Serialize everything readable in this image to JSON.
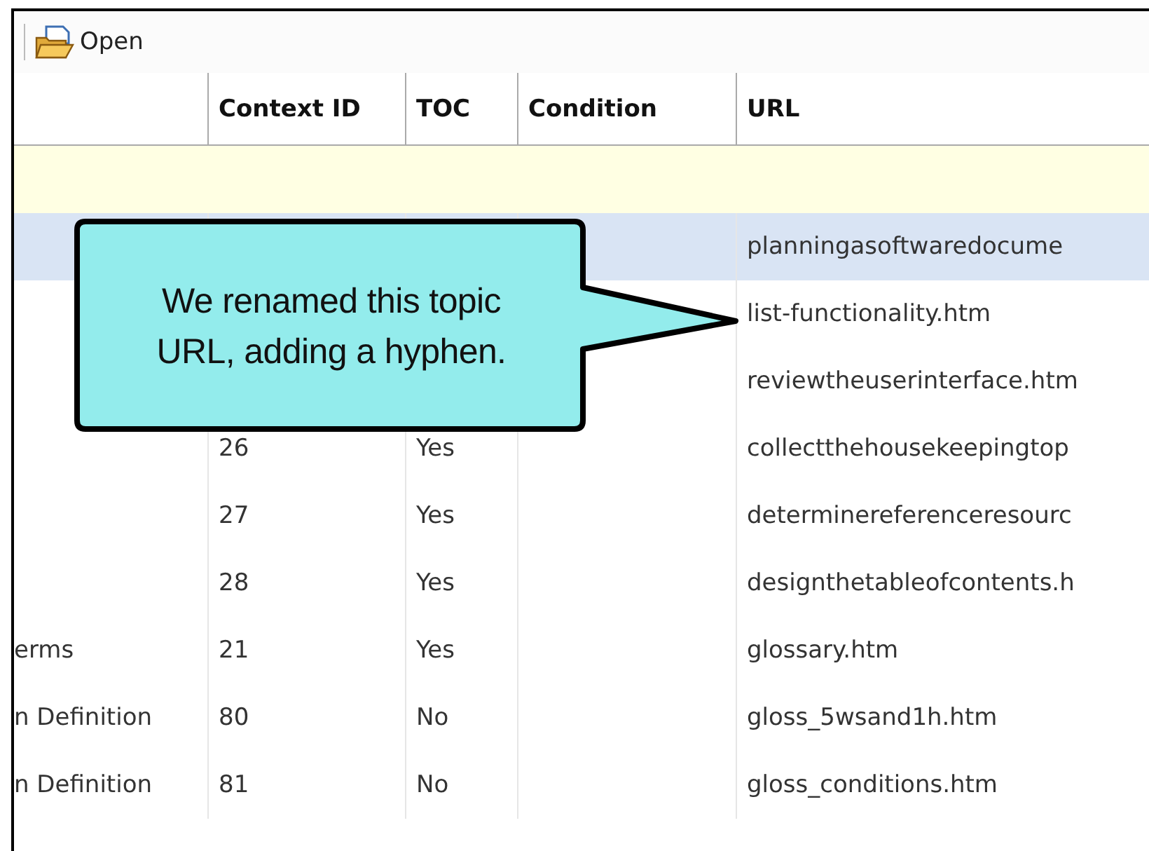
{
  "toolbar": {
    "buttons": [
      {
        "label": "Open"
      }
    ]
  },
  "table": {
    "columns": [
      {
        "label": "Context ID"
      },
      {
        "label": "TOC"
      },
      {
        "label": "Condition"
      },
      {
        "label": "URL"
      }
    ],
    "rows": [
      {
        "url": "planningasoftwaredocume",
        "selected": true
      },
      {
        "url": "list-functionality.htm",
        "selected": false
      },
      {
        "url": "reviewtheuserinterface.htm",
        "selected": false
      },
      {
        "context_id": "26",
        "toc": "Yes",
        "url": "collectthehousekeepingtop",
        "selected": false
      },
      {
        "context_id": "27",
        "toc": "Yes",
        "url": "determinereferenceresourc",
        "selected": false
      },
      {
        "context_id": "28",
        "toc": "Yes",
        "url": "designthetableofcontents.h",
        "selected": false
      },
      {
        "column_1": "erms",
        "context_id": "21",
        "toc": "Yes",
        "url": "glossary.htm",
        "selected": false
      },
      {
        "column_1": "n Definition",
        "context_id": "80",
        "toc": "No",
        "url": "gloss_5wsand1h.htm",
        "selected": false
      },
      {
        "column_1": "n Definition",
        "context_id": "81",
        "toc": "No",
        "url": "gloss_conditions.htm",
        "selected": false
      }
    ]
  },
  "callout": {
    "text": "We renamed this topic URL, adding a hyphen."
  }
}
